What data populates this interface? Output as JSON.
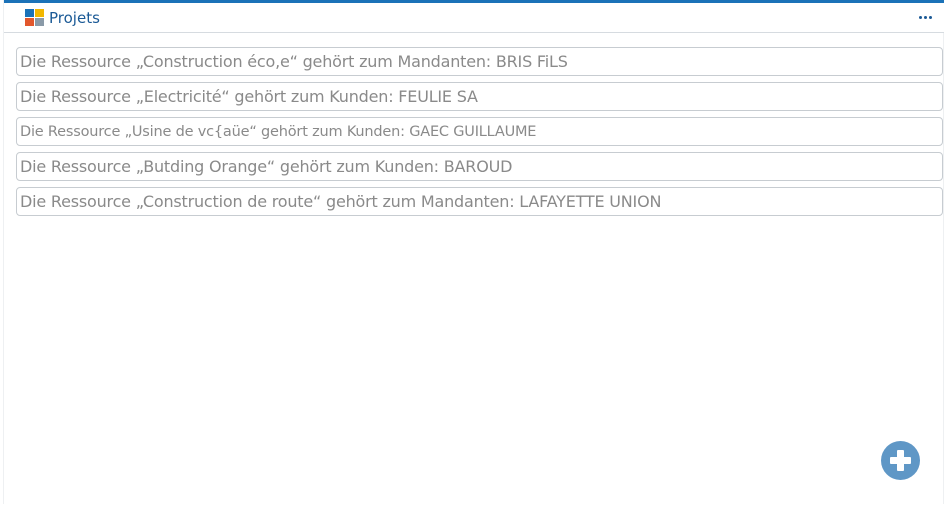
{
  "header": {
    "title": "Projets",
    "app_icon": "tiles-icon",
    "more_icon": "ellipsis-icon"
  },
  "colors": {
    "accent": "#1b72b8",
    "title": "#1b5a96",
    "item_text": "#8a8a8a",
    "item_border": "#c7ccd1",
    "add_button": "#5f97c6"
  },
  "resources": [
    {
      "text": "Die Ressource „Construction éco,e“ gehört zum Mandanten: BRIS FiLS"
    },
    {
      "text": "Die Ressource „Electricité“ gehört zum Kunden: FEULIE SA"
    },
    {
      "text": "Die Ressource „Usine de vc{aüe“ gehört zum Kunden: GAEC GUILLAUME"
    },
    {
      "text": "Die Ressource „Butding Orange“ gehört zum Kunden: BAROUD"
    },
    {
      "text": "Die Ressource „Construction de route“ gehört zum Mandanten: LAFAYETTE UNION"
    }
  ],
  "add_button": {
    "icon": "plus-circle-icon"
  }
}
